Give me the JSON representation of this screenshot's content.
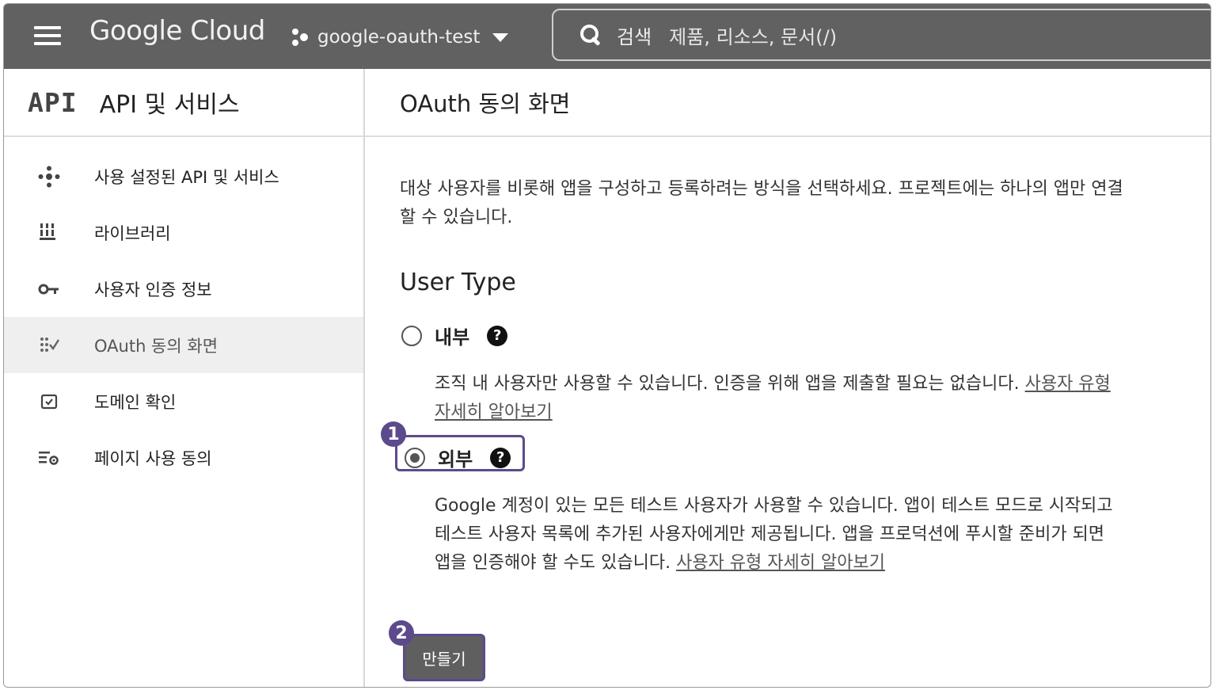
{
  "header": {
    "logo": "Google Cloud",
    "project": "google-oauth-test",
    "search_label": "검색",
    "search_placeholder": "제품, 리소스, 문서(/)"
  },
  "sidebar": {
    "badge": "API",
    "title": "API 및 서비스",
    "items": [
      {
        "label": "사용 설정된 API 및 서비스",
        "icon": "enabled-apis-icon"
      },
      {
        "label": "라이브러리",
        "icon": "library-icon"
      },
      {
        "label": "사용자 인증 정보",
        "icon": "key-icon"
      },
      {
        "label": "OAuth 동의 화면",
        "icon": "oauth-consent-icon",
        "active": true
      },
      {
        "label": "도메인 확인",
        "icon": "domain-check-icon"
      },
      {
        "label": "페이지 사용 동의",
        "icon": "page-consent-icon"
      }
    ]
  },
  "main": {
    "title": "OAuth 동의 화면",
    "description": "대상 사용자를 비롯해 앱을 구성하고 등록하려는 방식을 선택하세요. 프로젝트에는 하나의 앱만 연결할 수 있습니다.",
    "user_type_heading": "User Type",
    "options": [
      {
        "label": "내부",
        "selected": false,
        "description": "조직 내 사용자만 사용할 수 있습니다. 인증을 위해 앱을 제출할 필요는 없습니다. ",
        "link": "사용자 유형 자세히 알아보기"
      },
      {
        "label": "외부",
        "selected": true,
        "description": "Google 계정이 있는 모든 테스트 사용자가 사용할 수 있습니다. 앱이 테스트 모드로 시작되고 테스트 사용자 목록에 추가된 사용자에게만 제공됩니다. 앱을 프로덕션에 푸시할 준비가 되면 앱을 인증해야 할 수도 있습니다. ",
        "link": "사용자 유형 자세히 알아보기"
      }
    ],
    "create_button": "만들기",
    "help_glyph": "?"
  },
  "callouts": {
    "one": "1",
    "two": "2"
  },
  "colors": {
    "topbar": "#616161",
    "highlight": "#5c4a8c",
    "active_row": "#efefef"
  }
}
